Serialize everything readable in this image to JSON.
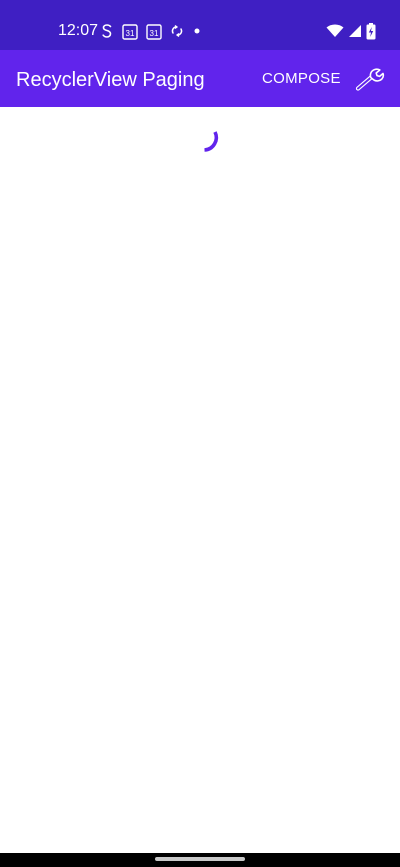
{
  "status_bar": {
    "time": "12:07",
    "calendar_day_1": "31",
    "calendar_day_2": "31",
    "icons": [
      "s-app-icon",
      "calendar-icon",
      "calendar-icon",
      "sync-icon",
      "dot-icon",
      "wifi-icon",
      "cell-signal-icon",
      "battery-charging-icon"
    ]
  },
  "app_bar": {
    "title": "RecyclerView Paging",
    "compose_label": "COMPOSE",
    "wrench_icon": "wrench-icon"
  },
  "content": {
    "loading_indicator": "progress-spinner"
  },
  "colors": {
    "status_bar": "#3f1fc3",
    "app_bar": "#6124ec",
    "accent": "#6124ec",
    "background": "#ffffff",
    "nav_bar": "#000000"
  }
}
